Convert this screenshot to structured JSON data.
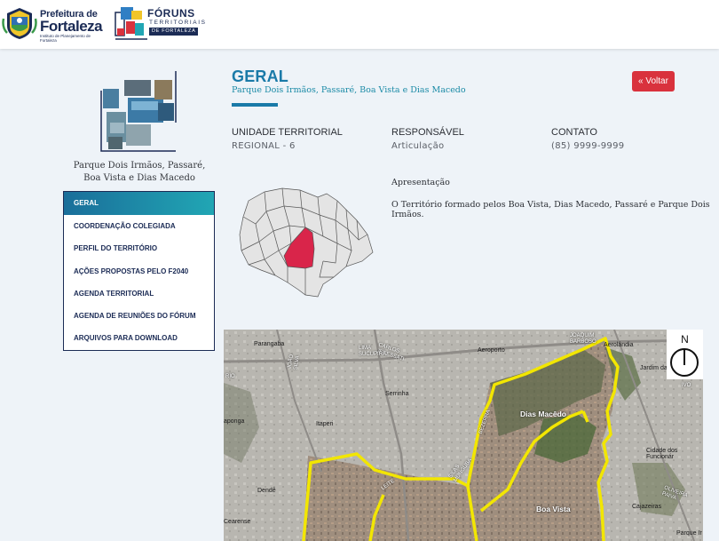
{
  "header": {
    "prefeitura": {
      "line1": "Prefeitura de",
      "line2": "Fortaleza",
      "line3": "Instituto de Planejamento de Fortaleza"
    },
    "foruns": {
      "title": "FÓRUNS",
      "sub1": "TERRITORIAIS",
      "sub2_de": "DE",
      "sub2_city": "FORTALEZA"
    }
  },
  "sidebar": {
    "territory_name": "Parque Dois Irmãos, Passaré, Boa Vista e Dias Macedo",
    "menu": [
      {
        "label": "GERAL",
        "active": true
      },
      {
        "label": "COORDENAÇÃO COLEGIADA",
        "active": false
      },
      {
        "label": "PERFIL DO TERRITÓRIO",
        "active": false
      },
      {
        "label": "AÇÕES PROPOSTAS PELO F2040",
        "active": false
      },
      {
        "label": "AGENDA TERRITORIAL",
        "active": false
      },
      {
        "label": "AGENDA DE REUNIÕES DO FÓRUM",
        "active": false
      },
      {
        "label": "ARQUIVOS PARA DOWNLOAD",
        "active": false
      }
    ]
  },
  "main": {
    "title": "GERAL",
    "subtitle": "Parque Dois Irmãos, Passaré, Boa Vista e Dias Macedo",
    "back_label": "« Voltar",
    "info": [
      {
        "label": "UNIDADE TERRITORIAL",
        "value": "REGIONAL - 6"
      },
      {
        "label": "RESPONSÁVEL",
        "value": "Articulação"
      },
      {
        "label": "CONTATO",
        "value": "(85) 9999-9999"
      }
    ],
    "apresentacao_label": "Apresentação",
    "apresentacao_text": "O Território formado pelos Boa Vista, Dias Macedo, Passaré e Parque Dois Irmãos."
  },
  "map": {
    "compass": "N",
    "labels": {
      "parangaba": "Parangaba",
      "aeroporto": "Aeroporto",
      "aerolandia": "Aerolândia",
      "jardim": "Jardim da",
      "serrinha": "Serrinha",
      "itaperi": "Itaperi",
      "dende": "Dendê",
      "dias_macedo": "Dias Macêdo",
      "boa_vista": "Boa Vista",
      "cidade_funcionarios": "Cidade dos Funcionár",
      "cajazeiras": "Cajazeiras",
      "cearense": "Cearense",
      "parque_iracema": "Parque Ir",
      "aponga": "aponga",
      "carlos": "CARLOS JERESSATI",
      "lima": "LIMA SUCUPIRA",
      "joao": "JOÃO SILVA",
      "joaquim": "JOAQUIM BARBOSO",
      "bezerra": "BEZERRA",
      "oliveira": "OLIVEIRA PAIVA",
      "silas": "SILAS MUNGUBA",
      "leite": "LEITE",
      "rio": "RIO",
      "ivo": "IVO"
    },
    "colors": {
      "boundary": "#f2e600",
      "highlight": "#d9254a"
    }
  }
}
